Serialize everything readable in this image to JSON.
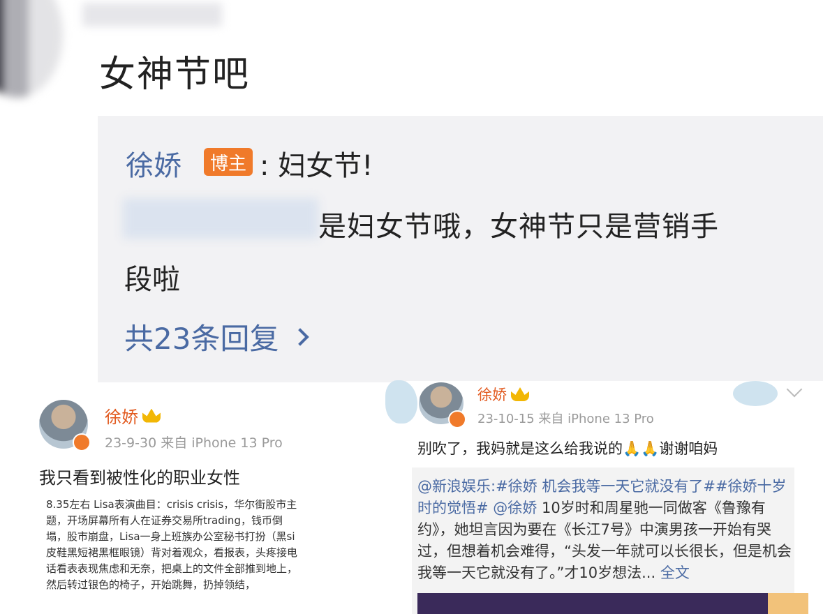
{
  "comment": {
    "text": "女神节吧"
  },
  "reply": {
    "author": "徐娇",
    "badge": "博主",
    "line1": ":  妇女节!",
    "line2": "是妇女节哦，女神节只是营销手",
    "line3": "段啦",
    "more": "共23条回复"
  },
  "post_left": {
    "author": "徐娇",
    "meta": "23-9-30   来自 iPhone 13 Pro",
    "title": "我只看到被性化的职业女性",
    "body": "8.35左右 Lisa表演曲目：crisis crisis，华尔街股市主题，开场屏幕所有人在证券交易所trading，钱币倒塌，股市崩盘，Lisa一身上班族办公室秘书打扮（黑si皮鞋黑短裙黑框眼镜）背对着观众，看报表，头疼接电话看表表现焦虑和无奈，把桌上的文件全部推到地上，然后转过银色的椅子，开始跳舞，扔掉领结，"
  },
  "post_right": {
    "author": "徐娇",
    "meta": "23-10-15   来自 iPhone 13 Pro",
    "text": "别吹了，我妈就是这么给我说的🙏🙏谢谢咱妈",
    "retweet_source": "@新浪娱乐",
    "retweet_topic1": ":#徐娇 机会我等一天它就没有了##徐娇十岁时的觉悟#",
    "retweet_mention": "@徐娇",
    "retweet_body": " 10岁时和周星驰一同做客《鲁豫有约》，她坦言因为要在《长江7号》中演男孩一开始有哭过，但想着机会难得，“头发一年就可以长很长，但是机会我等一天它就没有了。”才10岁想法...",
    "retweet_full": " 全文"
  },
  "colors": {
    "link_blue": "#4a6aa3",
    "vip_orange": "#e25a1f",
    "badge_orange": "#f07a2a"
  }
}
